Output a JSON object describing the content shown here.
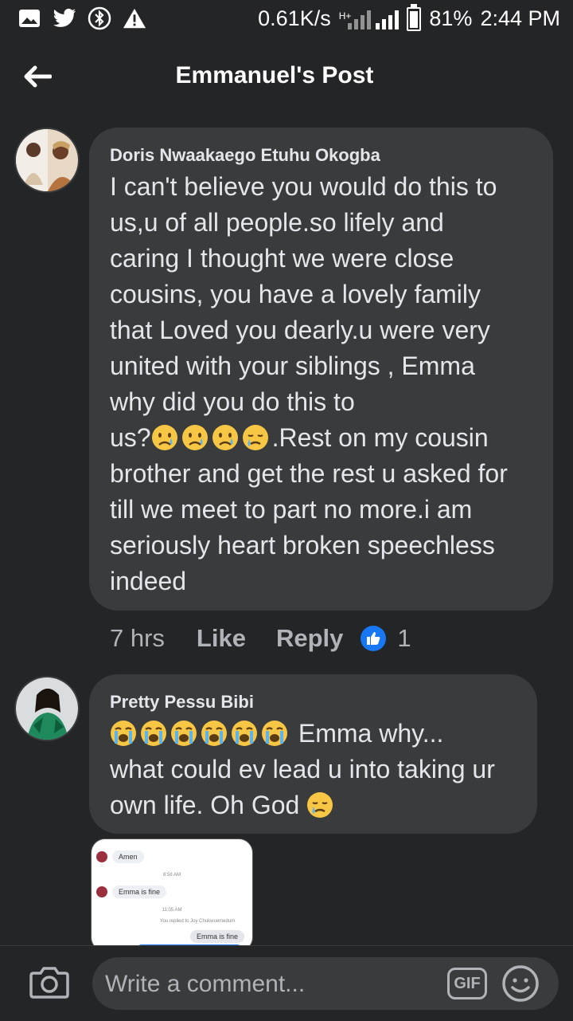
{
  "status_bar": {
    "net_speed": "0.61K/s",
    "network_type": "H+",
    "battery": "81%",
    "time": "2:44 PM",
    "icons": [
      "image-icon",
      "twitter-icon",
      "bluetooth-icon",
      "warning-icon",
      "signal-icon",
      "battery-icon"
    ]
  },
  "header": {
    "title": "Emmanuel's Post"
  },
  "comments": [
    {
      "author": "Doris Nwaakaego Etuhu Okogba",
      "lines": [
        "I can't believe you would do this to",
        "us,u of all people.so lifely and",
        "caring I thought we were close",
        "cousins, you have a lovely family",
        "that Loved you dearly.u were very",
        "united with your siblings , Emma",
        "why did you do this to"
      ],
      "emoji_line_prefix": "us?",
      "emoji_line_suffix": ".Rest on my cousin",
      "lines_after": [
        "brother and get the rest u asked for",
        "till we meet to part no more.i am",
        "seriously heart broken speechless",
        "indeed"
      ],
      "time": "7 hrs",
      "like_label": "Like",
      "reply_label": "Reply",
      "reaction_count": "1"
    },
    {
      "author": "Pretty Pessu Bibi",
      "first_line_suffix": "Emma why...",
      "line2": "what could ev lead u into taking ur",
      "line3": "own life. Oh God"
    }
  ],
  "attachment": {
    "msg1": "Amen",
    "time1": "8:58 AM",
    "msg2": "Emma is fine",
    "time2": "11:05 AM",
    "replied_note": "You replied to Joy Chukwuemedum",
    "quoted": "Emma is fine"
  },
  "comment_bar": {
    "placeholder": "Write a comment...",
    "gif_label": "GIF"
  },
  "colors": {
    "background": "#242526",
    "bubble": "#3a3b3c",
    "text": "#e4e6eb",
    "secondary_text": "#b0b3b8",
    "like_blue": "#1877f2"
  }
}
